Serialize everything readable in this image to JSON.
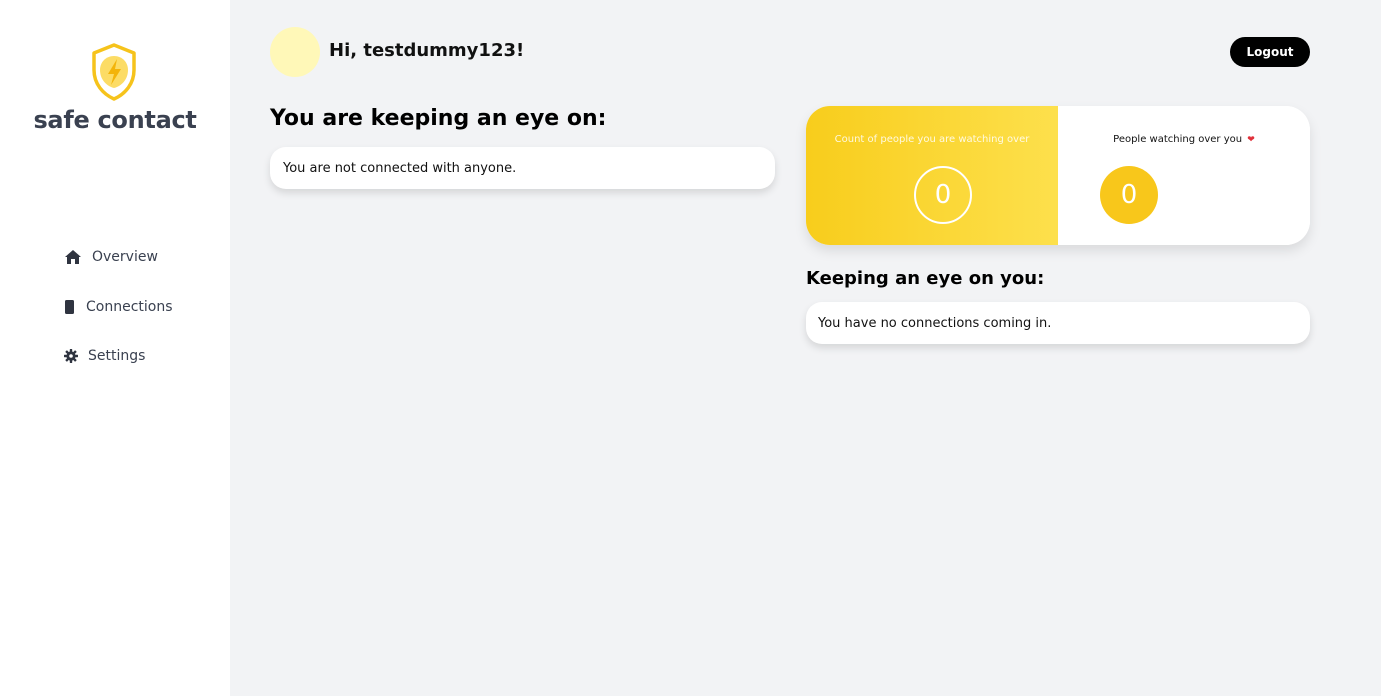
{
  "sidebar": {
    "brand": "safe contact",
    "logo_icon": "shield-lightning-icon",
    "items": [
      {
        "label": "Overview",
        "icon": "home-icon"
      },
      {
        "label": "Connections",
        "icon": "phone-icon"
      },
      {
        "label": "Settings",
        "icon": "gear-icon"
      }
    ]
  },
  "header": {
    "greeting": "Hi, testdummy123!",
    "logout_label": "Logout"
  },
  "watching": {
    "title": "You are keeping an eye on:",
    "empty_message": "You are not connected with anyone."
  },
  "stats": {
    "watching_label": "Count of people you are watching over",
    "watching_count": "0",
    "watchers_label": "People watching over you",
    "watchers_count": "0"
  },
  "watchers": {
    "title": "Keeping an eye on you:",
    "empty_message": "You have no connections coming in."
  },
  "colors": {
    "accent": "#f8c71b",
    "accent_light": "#fde04c",
    "avatar": "#fff8b8",
    "logout_bg": "#000000",
    "sidebar_text": "#3a4150",
    "heart": "#e0303a"
  }
}
